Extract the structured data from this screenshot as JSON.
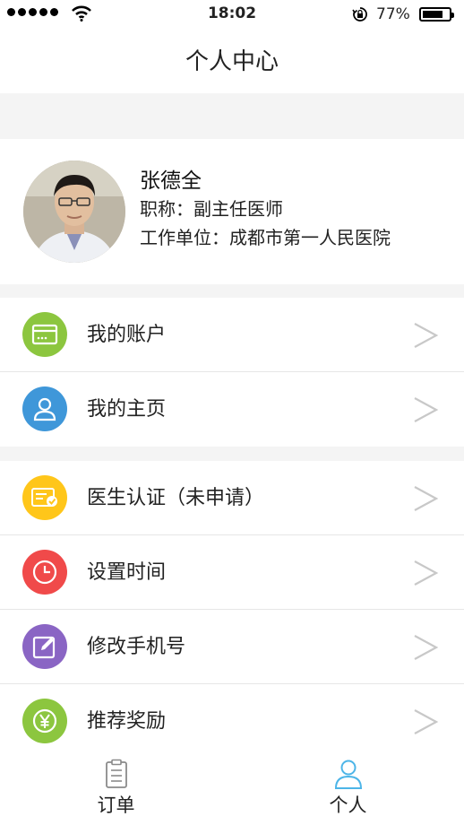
{
  "status_bar": {
    "time": "18:02",
    "battery": "77%",
    "battery_level": 0.77
  },
  "header": {
    "title": "个人中心"
  },
  "profile": {
    "name": "张德全",
    "title_line": "职称：副主任医师",
    "org_line": "工作单位：成都市第一人民医院"
  },
  "menu": [
    {
      "label": "我的账户",
      "icon": "wallet-card-icon",
      "color": "#8cc63f"
    },
    {
      "label": "我的主页",
      "icon": "user-icon",
      "color": "#3f97d9"
    },
    {
      "label": "医生认证（未申请）",
      "icon": "certificate-icon",
      "color": "#ffc61a"
    },
    {
      "label": "设置时间",
      "icon": "clock-icon",
      "color": "#f04a4a"
    },
    {
      "label": "修改手机号",
      "icon": "edit-icon",
      "color": "#8a65c4"
    },
    {
      "label": "推荐奖励",
      "icon": "yen-coin-icon",
      "color": "#8cc63f"
    }
  ],
  "tabbar": {
    "tabs": [
      {
        "label": "订单",
        "icon": "order-list-icon",
        "active": false
      },
      {
        "label": "个人",
        "icon": "person-icon",
        "active": true
      }
    ],
    "active_color": "#4db5e8"
  }
}
